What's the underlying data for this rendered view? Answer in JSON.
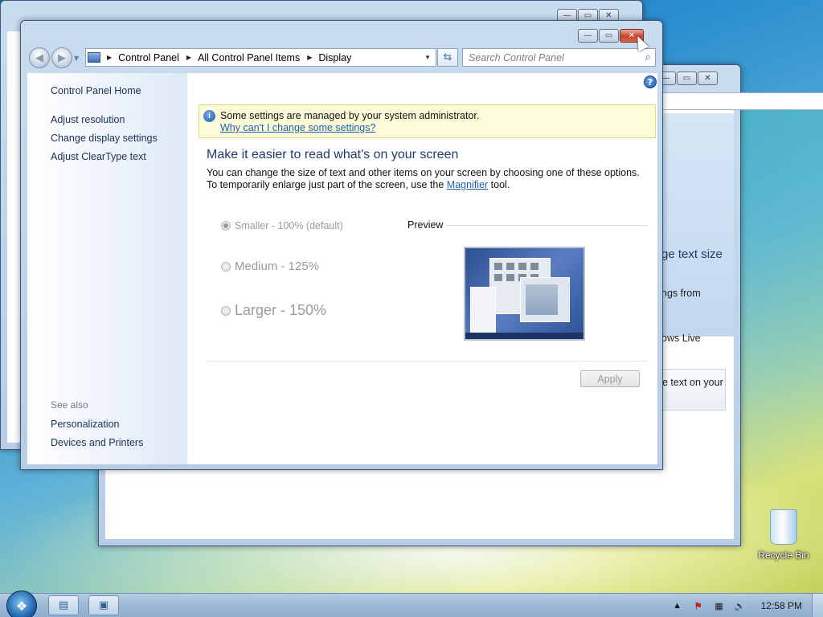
{
  "window_controls": {
    "minimize": "—",
    "maximize": "▭",
    "close": "✕"
  },
  "back_window_right": {
    "fragments": [
      "ge text size",
      "ngs from",
      "ows Live",
      "e text on your"
    ]
  },
  "nav": {
    "back_icon": "back-arrow-icon",
    "forward_icon": "forward-arrow-icon"
  },
  "address_bar": {
    "breadcrumbs": [
      "Control Panel",
      "All Control Panel Items",
      "Display"
    ]
  },
  "search": {
    "placeholder": "Search Control Panel"
  },
  "left_pane": {
    "home": "Control Panel Home",
    "links": [
      "Adjust resolution",
      "Change display settings",
      "Adjust ClearType text"
    ],
    "see_also_label": "See also",
    "see_also_links": [
      "Personalization",
      "Devices and Printers"
    ]
  },
  "infobar": {
    "message": "Some settings are managed by your system administrator.",
    "link": "Why can't I change some settings?"
  },
  "main": {
    "heading": "Make it easier to read what's on your screen",
    "description_before": "You can change the size of text and other items on your screen by choosing one of these options. To temporarily enlarge just part of the screen, use the ",
    "magnifier_link": "Magnifier",
    "description_after": " tool.",
    "options": [
      {
        "label": "Smaller - 100% (default)",
        "selected": true
      },
      {
        "label": "Medium - 125%",
        "selected": false
      },
      {
        "label": "Larger - 150%",
        "selected": false
      }
    ],
    "preview_label": "Preview",
    "apply_label": "Apply"
  },
  "desktop": {
    "recycle_bin_label": "Recycle Bin"
  },
  "taskbar": {
    "clock": "12:58 PM"
  },
  "colors": {
    "accent": "#1e3a6e",
    "link": "#1f5fb0",
    "infobar_bg": "#fdfcd9",
    "close_button": "#c8432b"
  }
}
